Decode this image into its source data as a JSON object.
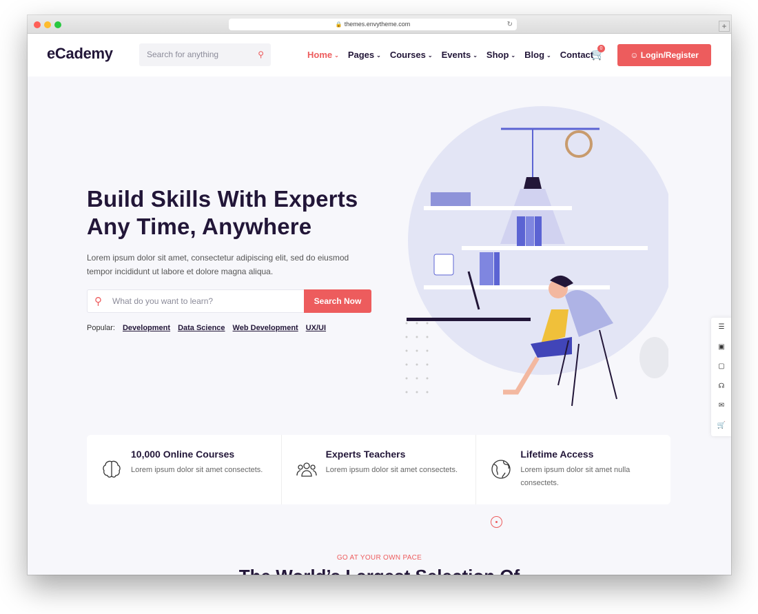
{
  "browser": {
    "url": "themes.envytheme.com"
  },
  "header": {
    "logo": "eCademy",
    "search_placeholder": "Search for anything",
    "nav": [
      {
        "label": "Home",
        "active": true,
        "has_dropdown": true
      },
      {
        "label": "Pages",
        "has_dropdown": true
      },
      {
        "label": "Courses",
        "has_dropdown": true
      },
      {
        "label": "Events",
        "has_dropdown": true
      },
      {
        "label": "Shop",
        "has_dropdown": true
      },
      {
        "label": "Blog",
        "has_dropdown": true
      },
      {
        "label": "Contact",
        "has_dropdown": false
      }
    ],
    "cart_count": "0",
    "login_label": "Login/Register"
  },
  "hero": {
    "title_line1": "Build Skills With Experts",
    "title_line2": "Any Time, Anywhere",
    "description": "Lorem ipsum dolor sit amet, consectetur adipiscing elit, sed do eiusmod tempor incididunt ut labore et dolore magna aliqua.",
    "search_placeholder": "What do you want to learn?",
    "search_button": "Search Now",
    "popular_label": "Popular:",
    "popular_tags": [
      "Development",
      "Data Science",
      "Web Development",
      "UX/UI"
    ]
  },
  "features": [
    {
      "icon": "brain-icon",
      "title": "10,000 Online Courses",
      "desc": "Lorem ipsum dolor sit amet consectets."
    },
    {
      "icon": "teachers-icon",
      "title": "Experts Teachers",
      "desc": "Lorem ipsum dolor sit amet consectets."
    },
    {
      "icon": "globe-icon",
      "title": "Lifetime Access",
      "desc": "Lorem ipsum dolor sit amet nulla consectets."
    }
  ],
  "section": {
    "subtitle": "GO AT YOUR OWN PACE",
    "title": "The World’s Largest Selection Of"
  },
  "colors": {
    "accent": "#ed5c5d",
    "dark": "#221638",
    "illus": "#5b63d3"
  }
}
